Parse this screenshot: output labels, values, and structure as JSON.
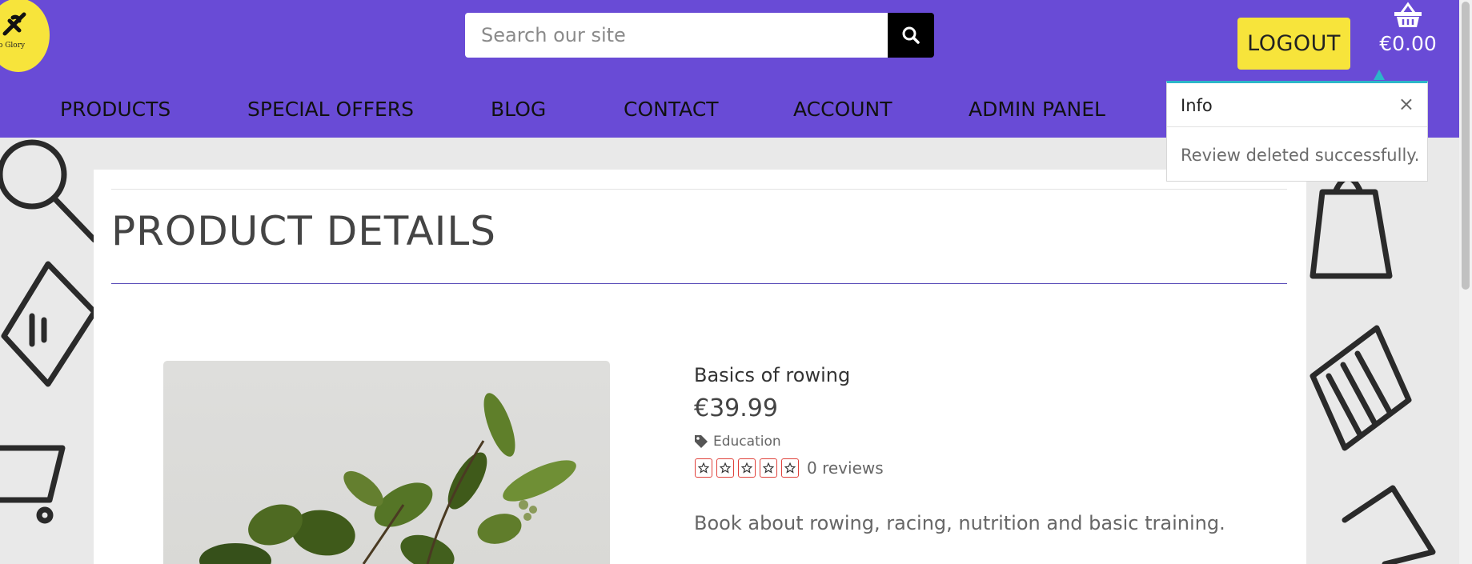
{
  "header": {
    "logo_text": "n To Glory",
    "search": {
      "placeholder": "Search our site",
      "value": ""
    },
    "logout_label": "LOGOUT",
    "cart_amount": "€0.00"
  },
  "nav": {
    "items": [
      {
        "label": "PRODUCTS"
      },
      {
        "label": "SPECIAL OFFERS"
      },
      {
        "label": "BLOG"
      },
      {
        "label": "CONTACT"
      },
      {
        "label": "ACCOUNT"
      },
      {
        "label": "ADMIN PANEL"
      }
    ]
  },
  "toast": {
    "title": "Info",
    "close": "×",
    "message": "Review deleted successfully.",
    "accent_color": "#2cb6c9"
  },
  "main": {
    "page_title": "PRODUCT DETAILS",
    "product": {
      "name": "Basics of rowing",
      "price": "€39.99",
      "category": "Education",
      "rating_stars": 5,
      "rating_value": 0,
      "reviews": "0 reviews",
      "description": "Book about rowing, racing, nutrition and basic training."
    }
  },
  "colors": {
    "header_bg": "#694bd6",
    "accent_yellow": "#f7e43b",
    "star_border": "#e0413b"
  },
  "icons": {
    "search": "search-icon",
    "cart": "basket-icon",
    "tag": "tag-icon",
    "star": "star-outline-icon",
    "close": "close-icon"
  }
}
